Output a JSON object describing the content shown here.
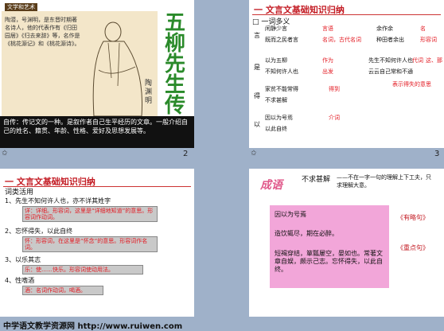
{
  "footer": {
    "text": "中学语文教学资源网 http://www.ruiwen.com"
  },
  "slide1": {
    "tag": "文学和艺术",
    "intro": "陶潜，号渊明，是东晋时期著名诗人，他的代表作有《归田园居》《归去来辞》等，名作是《桃花源记》和《桃花源诗》。",
    "portrait_name": "陶渊明",
    "title_chars": [
      "五",
      "柳",
      "先",
      "生",
      "传"
    ],
    "note": "自传：传记文的一种。是叙作者自己生平经历的文章。一般介绍自己的姓名、籍贯、年龄、性格、爱好及思想发展等。",
    "page": "2"
  },
  "slide2": {
    "title": "一 文言文基础知识归纳",
    "section": "□ 一词多义",
    "rows": [
      {
        "char": "言",
        "a": "闲静少言",
        "b": "既而之民者言",
        "ra": "言语",
        "rb": "名词，古代名词",
        "c": "余作余",
        "d": "种田者余出",
        "rc": "名",
        "rd": "形容词"
      },
      {
        "char": "是",
        "a": "以为五柳",
        "b": "不知何许人也",
        "ra": "作为",
        "rb": "出发",
        "c": "先生不知何许人也",
        "d": "云云自己常和不通",
        "rc": "代词",
        "rd": "这、那"
      },
      {
        "char": "得",
        "a": "家贫不能常得",
        "b": "不求甚解",
        "ra": "得到",
        "rb": "",
        "c": "",
        "d": "",
        "rc": "表示得失的意思",
        "rd": ""
      },
      {
        "char": "以",
        "a": "因以为号焉",
        "b": "以此自终",
        "ra": "介词",
        "rb": "",
        "c": "",
        "d": "",
        "rc": "",
        "rd": ""
      }
    ],
    "page": "3"
  },
  "slide3": {
    "title": "一 文言文基础知识归纳",
    "section": "词类活用",
    "items": [
      {
        "q": "1、先生不知何许人也，亦不详其姓字",
        "a": "详：详细。形容词，这里是“详细地知道”的意思。形容词作动词。"
      },
      {
        "q": "2、忘怀得失，以此自终",
        "a": "怀：形容词，在这里是“怀念”的意思。形容词作名词。"
      },
      {
        "q": "3、以乐其志",
        "a": "乐：使……快乐。形容词使动用法。"
      },
      {
        "q": "4、性嗜酒",
        "a": "酒：名词作动词，喝酒。"
      }
    ]
  },
  "slide4": {
    "badge": "成语",
    "def_title": "不求甚解",
    "def_text": "——不在一字一句的理解上下工夫，只求理解大意。",
    "box_lines": [
      "因以为号焉",
      "造饮辄尽，期在必醉。",
      "短褐穿结，箪瓢屡空，晏如也。常著文章自娱，颇示己志。忘怀得失，以此自终。"
    ],
    "tag1": "《有略句》",
    "tag2": "《重点句》"
  }
}
